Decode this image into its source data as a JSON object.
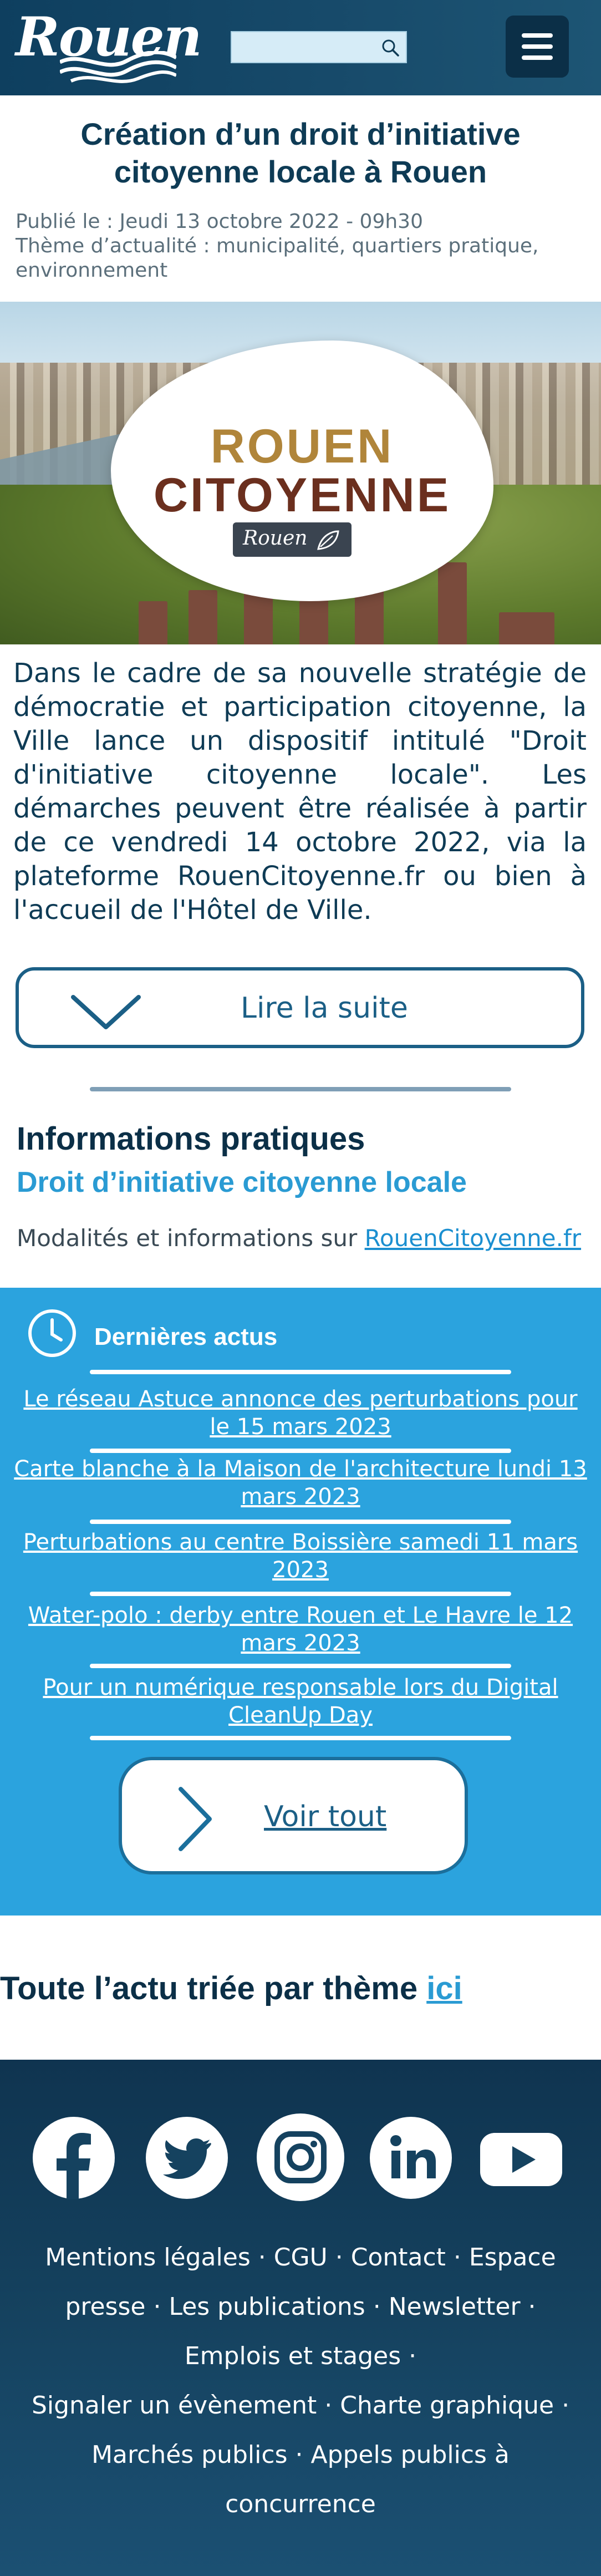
{
  "header": {
    "logo_text": "Rouen",
    "search_placeholder": "",
    "icons": {
      "search": "search-icon",
      "menu": "hamburger-menu-icon"
    }
  },
  "article": {
    "title": "Création d’un droit d’initiative citoyenne locale à Rouen",
    "published": "Publié le : Jeudi 13 octobre 2022 - 09h30",
    "themes_line1": "Thème d’actualité : municipalité, quartiers pratique,",
    "themes_line2": "environnement",
    "hero": {
      "line1": "ROUEN",
      "line2": "CITOYENNE",
      "badge": "Rouen"
    },
    "intro": "Dans le cadre de sa nouvelle stratégie de démocratie et participation citoyenne, la Ville lance un dispositif intitulé \"Droit d'initiative citoyenne locale\". Les démarches peuvent être réalisée à partir de ce vendredi 14 octobre 2022, via la plateforme RouenCitoyenne.fr ou bien à l'accueil de l'Hôtel de Ville.",
    "read_more": "Lire la suite"
  },
  "info": {
    "title": "Informations pratiques",
    "subtitle": "Droit d’initiative citoyenne locale",
    "line_prefix": "Modalités et informations sur ",
    "link": "RouenCitoyenne.fr"
  },
  "news": {
    "heading": "Dernières actus",
    "items": [
      {
        "line1": "Le réseau Astuce annonce des perturbations pour",
        "line2": "le 15 mars 2023"
      },
      {
        "line1": "Carte blanche à la Maison de l'architecture lundi 13",
        "line2": "mars 2023"
      },
      {
        "line1": "Perturbations au centre Boissière samedi 11 mars",
        "line2": "2023"
      },
      {
        "line1": "Water-polo : derby entre Rouen et Le Havre le 12",
        "line2": "mars 2023"
      },
      {
        "line1": "Pour un numérique responsable lors du Digital",
        "line2": "CleanUp Day"
      }
    ],
    "see_all": "Voir tout"
  },
  "theme": {
    "prefix": "Toute l’actu triée par thème ",
    "link": "ici"
  },
  "footer": {
    "social": [
      "facebook-icon",
      "twitter-icon",
      "instagram-icon",
      "linkedin-icon",
      "youtube-icon"
    ],
    "links": {
      "mentions": "Mentions légales",
      "cgu": "CGU",
      "contact": "Contact",
      "espace": "Espace",
      "presse": "presse",
      "publications": "Les publications",
      "newsletter": "Newsletter",
      "emplois": "Emplois et stages",
      "signaler": "Signaler un évènement",
      "charte": "Charte graphique",
      "marches": "Marchés publics",
      "appels1": "Appels publics à",
      "appels2": "concurrence",
      "sep": " · "
    }
  },
  "colors": {
    "header_bg": "#0e3f5f",
    "brand_dark": "#0e3b55",
    "accent_blue": "#2ba3de",
    "link_blue": "#1b8fd0",
    "button_border": "#1b5f86"
  }
}
